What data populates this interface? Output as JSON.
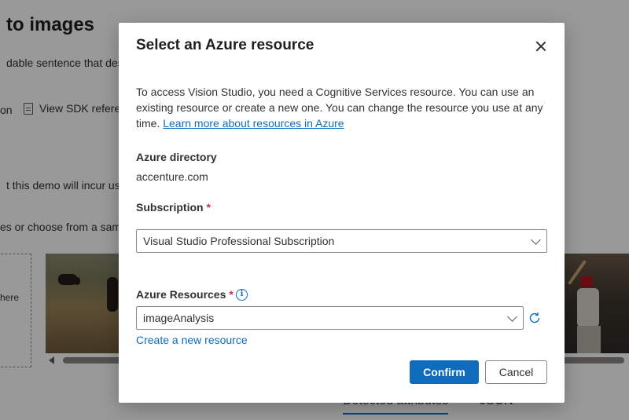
{
  "background": {
    "title": "to images",
    "description": "dable sentence that describ",
    "link_fragment": "on",
    "sdk_link": "View SDK referen",
    "warning": "t this demo will incur usag",
    "browse_text": "es or choose from a samp",
    "dropzone_text": "here",
    "tabs": [
      "Detected attributes",
      "JSON"
    ]
  },
  "dialog": {
    "title": "Select an Azure resource",
    "intro_text": "To access Vision Studio, you need a Cognitive Services resource. You can use an existing resource or create a new one. You can change the resource you use at any time. ",
    "intro_link": "Learn more about resources in Azure",
    "directory_label": "Azure directory",
    "directory_value": "accenture.com",
    "subscription_label": "Subscription",
    "subscription_value": "Visual Studio Professional Subscription",
    "resources_label": "Azure Resources",
    "required_marker": "*",
    "resource_value": "imageAnalysis",
    "create_link": "Create a new resource",
    "confirm_label": "Confirm",
    "cancel_label": "Cancel"
  },
  "colors": {
    "accent": "#0f6cbd",
    "required": "#c4314b"
  },
  "icons": {
    "close": "close-icon",
    "info": "info-icon",
    "refresh": "refresh-icon",
    "chevron": "chevron-down-icon",
    "document": "document-icon"
  }
}
